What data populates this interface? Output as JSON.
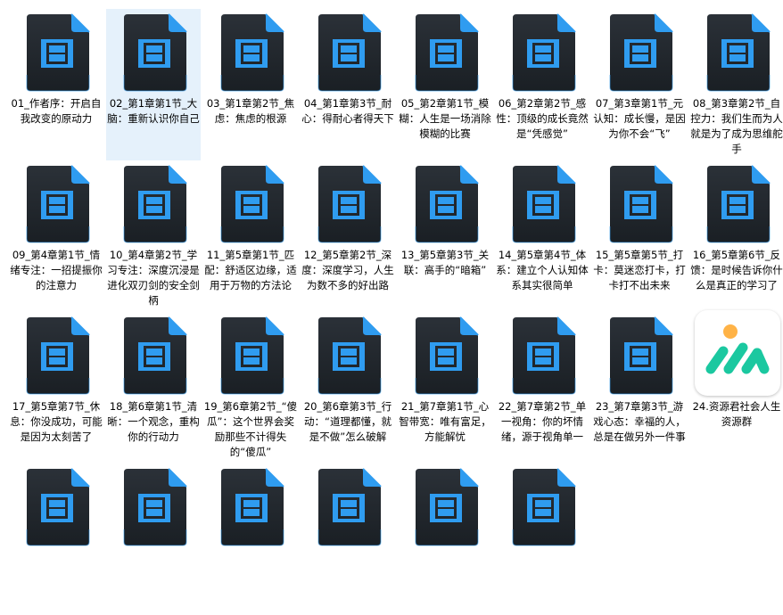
{
  "files": [
    {
      "name": "01_作者序：开启自我改变的原动力",
      "type": "video",
      "selected": false
    },
    {
      "name": "02_第1章第1节_大脑：重新认识你自己",
      "type": "video",
      "selected": true
    },
    {
      "name": "03_第1章第2节_焦虑：焦虑的根源",
      "type": "video",
      "selected": false
    },
    {
      "name": "04_第1章第3节_耐心：得耐心者得天下",
      "type": "video",
      "selected": false
    },
    {
      "name": "05_第2章第1节_模糊：人生是一场消除模糊的比赛",
      "type": "video",
      "selected": false
    },
    {
      "name": "06_第2章第2节_感性：顶级的成长竟然是“凭感觉”",
      "type": "video",
      "selected": false
    },
    {
      "name": "07_第3章第1节_元认知：成长慢，是因为你不会“飞”",
      "type": "video",
      "selected": false
    },
    {
      "name": "08_第3章第2节_自控力：我们生而为人就是为了成为思维舵手",
      "type": "video",
      "selected": false
    },
    {
      "name": "09_第4章第1节_情绪专注：一招提振你的注意力",
      "type": "video",
      "selected": false
    },
    {
      "name": "10_第4章第2节_学习专注：深度沉浸是进化双刃剑的安全剑柄",
      "type": "video",
      "selected": false
    },
    {
      "name": "11_第5章第1节_匹配：舒适区边缘，适用于万物的方法论",
      "type": "video",
      "selected": false
    },
    {
      "name": "12_第5章第2节_深度：深度学习，人生为数不多的好出路",
      "type": "video",
      "selected": false
    },
    {
      "name": "13_第5章第3节_关联：高手的“暗箱”",
      "type": "video",
      "selected": false
    },
    {
      "name": "14_第5章第4节_体系：建立个人认知体系其实很简单",
      "type": "video",
      "selected": false
    },
    {
      "name": "15_第5章第5节_打卡：莫迷恋打卡，打卡打不出未来",
      "type": "video",
      "selected": false
    },
    {
      "name": "16_第5章第6节_反馈：是时候告诉你什么是真正的学习了",
      "type": "video",
      "selected": false
    },
    {
      "name": "17_第5章第7节_休息：你没成功，可能是因为太刻苦了",
      "type": "video",
      "selected": false
    },
    {
      "name": "18_第6章第1节_清晰：一个观念，重构你的行动力",
      "type": "video",
      "selected": false
    },
    {
      "name": "19_第6章第2节_“傻瓜”：这个世界会奖励那些不计得失的“傻瓜”",
      "type": "video",
      "selected": false
    },
    {
      "name": "20_第6章第3节_行动：“道理都懂，就是不做”怎么破解",
      "type": "video",
      "selected": false
    },
    {
      "name": "21_第7章第1节_心智带宽：唯有富足，方能解忧",
      "type": "video",
      "selected": false
    },
    {
      "name": "22_第7章第2节_单一视角：你的坏情绪，源于视角单一",
      "type": "video",
      "selected": false
    },
    {
      "name": "23_第7章第3节_游戏心态：幸福的人，总是在做另外一件事",
      "type": "video",
      "selected": false
    },
    {
      "name": "24.资源君社会人生资源群",
      "type": "app",
      "selected": false
    }
  ],
  "colors": {
    "selection": "#e5f1fb",
    "icon_body": "#1a1f24",
    "icon_accent": "#2f9cf0",
    "app_green": "#1bc8a0",
    "app_orange": "#ffb347"
  }
}
